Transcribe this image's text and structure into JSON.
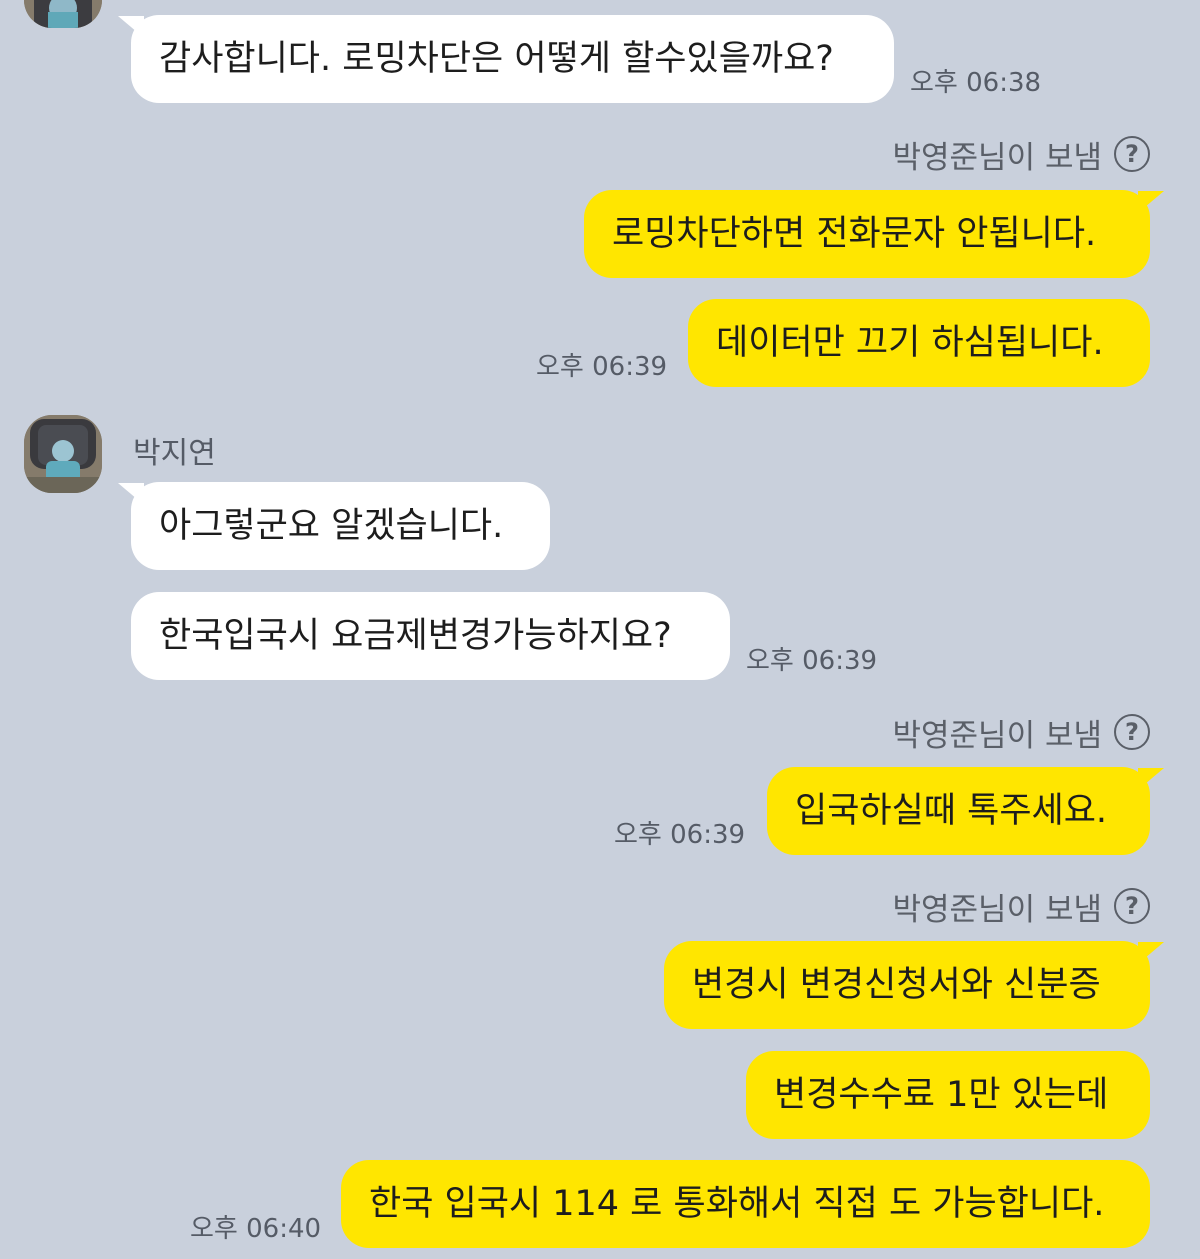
{
  "conversation": {
    "other_user": "박지연",
    "sent_by_label": "박영준님이 보냄",
    "help_glyph": "?"
  },
  "messages": [
    {
      "side": "in",
      "text": "감사합니다. 로밍차단은 어떻게 할수있을까요?",
      "time": "오후 06:38"
    },
    {
      "side": "out",
      "text": "로밍차단하면 전화문자 안됩니다."
    },
    {
      "side": "out",
      "text": "데이터만 끄기 하심됩니다.",
      "time": "오후 06:39"
    },
    {
      "side": "in",
      "text": "아그렇군요 알겠습니다."
    },
    {
      "side": "in",
      "text": "한국입국시 요금제변경가능하지요?",
      "time": "오후 06:39"
    },
    {
      "side": "out",
      "text": "입국하실때 톡주세요.",
      "time": "오후 06:39"
    },
    {
      "side": "out",
      "text": "변경시 변경신청서와 신분증"
    },
    {
      "side": "out",
      "text": "변경수수료 1만 있는데"
    },
    {
      "side": "out",
      "text": "한국 입국시 114 로 통화해서 직접 도 가능합니다.",
      "time": "오후 06:40"
    }
  ],
  "colors": {
    "background": "#c9d0dc",
    "incoming_bubble": "#ffffff",
    "outgoing_bubble": "#ffe600"
  }
}
